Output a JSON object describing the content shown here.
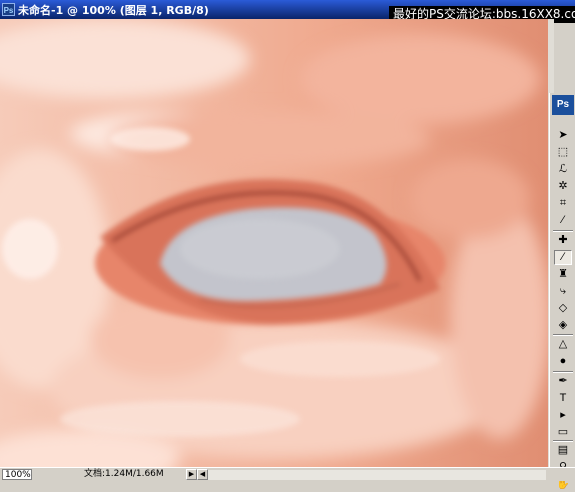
{
  "window": {
    "icon": "photoshop-icon",
    "title": "未命名-1 @ 100% (图层 1, RGB/8)"
  },
  "watermark": "最好的PS交流论坛:bbs.16XX8.com",
  "statusbar": {
    "zoom": "100%",
    "doc_info": "文档:1.24M/1.66M",
    "arrow_right": "▶",
    "arrow_left": "◀"
  },
  "toolbox": {
    "logo": "Ps",
    "tools": [
      {
        "name": "move-tool-icon",
        "glyph": "➤"
      },
      {
        "name": "marquee-tool-icon",
        "glyph": "⬚"
      },
      {
        "name": "lasso-tool-icon",
        "glyph": "ℒ"
      },
      {
        "name": "magic-wand-tool-icon",
        "glyph": "✲"
      },
      {
        "name": "crop-tool-icon",
        "glyph": "⌗"
      },
      {
        "name": "slice-tool-icon",
        "glyph": "⁄"
      },
      {
        "name": "healing-brush-tool-icon",
        "glyph": "✚"
      },
      {
        "name": "brush-tool-icon",
        "glyph": "∕"
      },
      {
        "name": "clone-stamp-tool-icon",
        "glyph": "♜"
      },
      {
        "name": "history-brush-tool-icon",
        "glyph": "⤷"
      },
      {
        "name": "eraser-tool-icon",
        "glyph": "◇"
      },
      {
        "name": "paint-bucket-tool-icon",
        "glyph": "◈"
      },
      {
        "name": "blur-tool-icon",
        "glyph": "△"
      },
      {
        "name": "dodge-tool-icon",
        "glyph": "●"
      },
      {
        "name": "pen-tool-icon",
        "glyph": "✒"
      },
      {
        "name": "type-tool-icon",
        "glyph": "T"
      },
      {
        "name": "path-selection-tool-icon",
        "glyph": "▸"
      },
      {
        "name": "rectangle-tool-icon",
        "glyph": "▭"
      },
      {
        "name": "notes-tool-icon",
        "glyph": "▤"
      },
      {
        "name": "eyedropper-tool-icon",
        "glyph": "⚲"
      },
      {
        "name": "hand-tool-icon",
        "glyph": "✋"
      }
    ],
    "active_tool": "brush-tool-icon"
  },
  "colors": {
    "titlebar": "#0a246a",
    "skin": "#f2b7a0",
    "eye_white": "#c2c4cc",
    "lid": "#d9735a"
  }
}
